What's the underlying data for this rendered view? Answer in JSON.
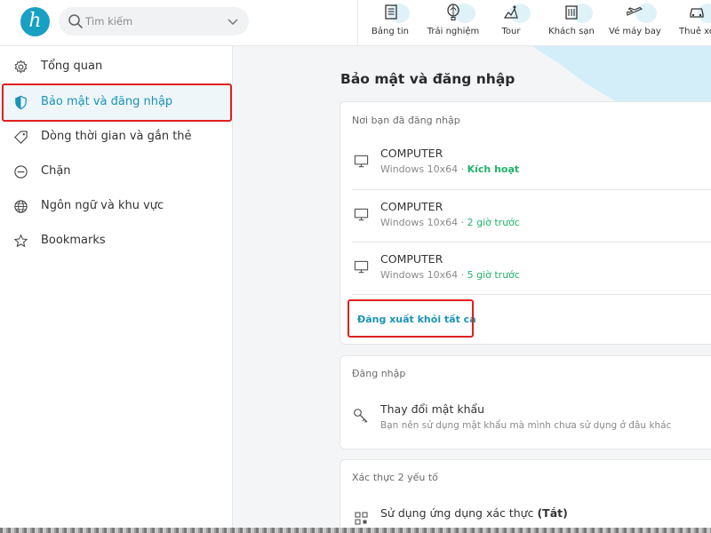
{
  "search": {
    "placeholder": "Tìm kiếm"
  },
  "nav": [
    {
      "label": "Bảng tin",
      "icon": "news-icon"
    },
    {
      "label": "Trải nghiệm",
      "icon": "balloon-icon"
    },
    {
      "label": "Tour",
      "icon": "tour-icon"
    },
    {
      "label": "Khách sạn",
      "icon": "hotel-icon"
    },
    {
      "label": "Vé máy bay",
      "icon": "plane-icon"
    },
    {
      "label": "Thuê xe",
      "icon": "car-icon"
    }
  ],
  "sidebar": {
    "items": [
      {
        "label": "Tổng quan",
        "icon": "gear-icon"
      },
      {
        "label": "Bảo mật và đăng nhập",
        "icon": "shield-icon"
      },
      {
        "label": "Dòng thời gian và gắn thẻ",
        "icon": "tag-icon"
      },
      {
        "label": "Chặn",
        "icon": "block-icon"
      },
      {
        "label": "Ngôn ngữ và khu vực",
        "icon": "globe-icon"
      },
      {
        "label": "Bookmarks",
        "icon": "star-icon"
      }
    ]
  },
  "main": {
    "title": "Bảo mật và đăng nhập",
    "sessions_card": {
      "heading": "Nơi bạn đã đăng nhập",
      "sessions": [
        {
          "device": "COMPUTER",
          "os": "Windows 10x64 · ",
          "status": "Kích hoạt"
        },
        {
          "device": "COMPUTER",
          "os": "Windows 10x64 · ",
          "status": "2 giờ trước"
        },
        {
          "device": "COMPUTER",
          "os": "Windows 10x64 · ",
          "status": "5 giờ trước"
        }
      ],
      "logout_all": "Đăng xuất khỏi tất cả"
    },
    "login_card": {
      "heading": "Đăng nhập",
      "change_password": "Thay đổi mật khẩu",
      "change_password_hint": "Bạn nên sử dụng mật khẩu mà mình chưa sử dụng ở đâu khác"
    },
    "twofa_card": {
      "heading": "Xác thực 2 yếu tố",
      "app_auth": "Sử dụng ứng dụng xác thực",
      "app_auth_state": "(Tắt)"
    }
  },
  "colors": {
    "accent": "#1a93b8",
    "brand": "#17a0c4",
    "green": "#21b26b",
    "highlight": "#e02020"
  }
}
